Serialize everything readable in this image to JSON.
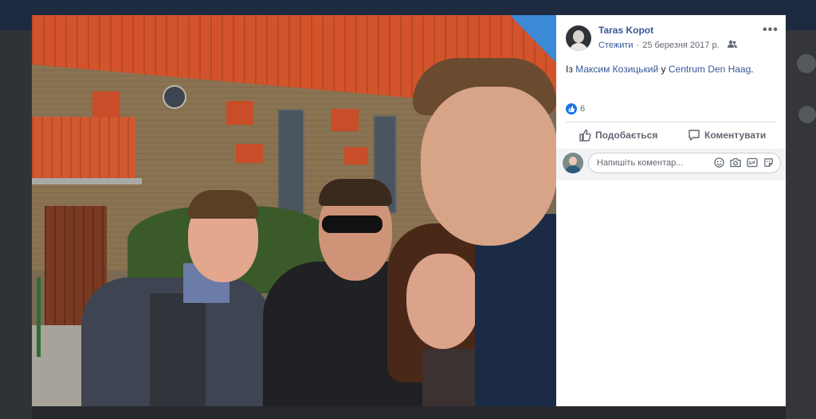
{
  "post": {
    "author": "Taras Kopot",
    "follow_label": "Стежити",
    "separator": "·",
    "date": "25 березня 2017 р.",
    "text_prefix": "Із",
    "tagged_person": "Максим Козицький",
    "text_middle": "у",
    "location": "Centrum Den Haag",
    "text_suffix": ".",
    "like_count": "6",
    "like_label": "Подобається",
    "comment_label": "Коментувати",
    "comment_placeholder": "Напишіть коментар...",
    "audience_icon": "friends-icon",
    "options_icon": "more-options-icon"
  },
  "colors": {
    "link": "#385898",
    "like_blue": "#1b74e4",
    "sidebar_bg": "#ffffff",
    "backdrop": "#2b2e33"
  }
}
